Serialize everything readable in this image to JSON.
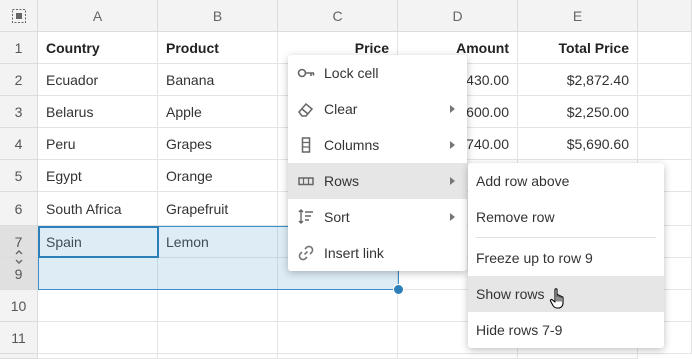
{
  "columns": [
    "A",
    "B",
    "C",
    "D",
    "E"
  ],
  "rows": [
    {
      "num": "1",
      "a": "Country",
      "b": "Product",
      "c": "Price",
      "d": "Amount",
      "e": "Total Price"
    },
    {
      "num": "2",
      "a": "Ecuador",
      "b": "Banana",
      "c": "",
      "d": "430.00",
      "e": "$2,872.40"
    },
    {
      "num": "3",
      "a": "Belarus",
      "b": "Apple",
      "c": "",
      "d": "600.00",
      "e": "$2,250.00"
    },
    {
      "num": "4",
      "a": "Peru",
      "b": "Grapes",
      "c": "",
      "d": "740.00",
      "e": "$5,690.60"
    },
    {
      "num": "5",
      "a": "Egypt",
      "b": "Orange",
      "c": "",
      "d": "",
      "e": ""
    },
    {
      "num": "6",
      "a": "South Africa",
      "b": "Grapefruit",
      "c": "",
      "d": "",
      "e": ""
    },
    {
      "num": "7",
      "a": "Spain",
      "b": "Lemon",
      "c": "",
      "d": "",
      "e": ""
    },
    {
      "num": "9",
      "a": "",
      "b": "",
      "c": "",
      "d": "",
      "e": ""
    },
    {
      "num": "10",
      "a": "",
      "b": "",
      "c": "",
      "d": "",
      "e": ""
    },
    {
      "num": "11",
      "a": "",
      "b": "",
      "c": "",
      "d": "",
      "e": ""
    }
  ],
  "context_menu": {
    "items": [
      {
        "label": "Lock cell",
        "icon": "key-icon"
      },
      {
        "label": "Clear",
        "icon": "eraser-icon",
        "submenu": true
      },
      {
        "label": "Columns",
        "icon": "columns-icon",
        "submenu": true
      },
      {
        "label": "Rows",
        "icon": "rows-icon",
        "submenu": true,
        "highlighted": true
      },
      {
        "label": "Sort",
        "icon": "sort-icon",
        "submenu": true
      },
      {
        "label": "Insert link",
        "icon": "link-icon"
      }
    ]
  },
  "rows_submenu": {
    "items": [
      {
        "label": "Add row above"
      },
      {
        "label": "Remove row"
      },
      {
        "label": "Freeze up to row 9"
      },
      {
        "label": "Show rows",
        "highlighted": true
      },
      {
        "label": "Hide rows 7-9"
      }
    ]
  },
  "colors": {
    "selection_border": "#2c7fb8",
    "menu_highlight": "#e6e6e6"
  }
}
